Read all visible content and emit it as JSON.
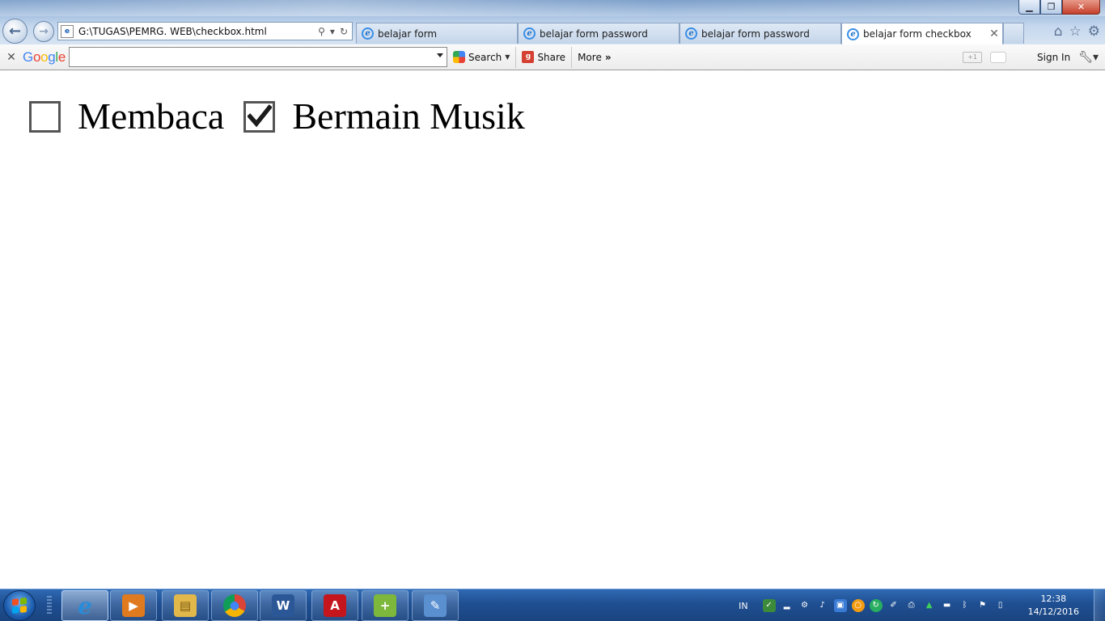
{
  "window": {
    "minimize_glyph": "▁",
    "restore_glyph": "❐",
    "close_glyph": "✕"
  },
  "nav": {
    "back_glyph": "←",
    "forward_glyph": "→",
    "address": "G:\\TUGAS\\PEMRG. WEB\\checkbox.html",
    "address_icons": [
      "search-icon",
      "dropdown-icon",
      "refresh-icon"
    ]
  },
  "tabs": [
    {
      "label": "belajar form",
      "active": false
    },
    {
      "label": "belajar form password",
      "active": false
    },
    {
      "label": "belajar form password",
      "active": false
    },
    {
      "label": "belajar form checkbox",
      "active": true
    }
  ],
  "browser_icons": [
    "home-icon",
    "favorites-star-icon",
    "settings-gear-icon"
  ],
  "google_toolbar": {
    "logo_letters": [
      "G",
      "o",
      "o",
      "g",
      "l",
      "e"
    ],
    "search_value": "",
    "search_button": "Search",
    "share_button": "Share",
    "more_button": "More",
    "more_glyph": "»",
    "sign_in": "Sign In"
  },
  "page": {
    "checkboxes": [
      {
        "label": "Membaca",
        "checked": false
      },
      {
        "label": "Bermain Musik",
        "checked": true
      }
    ]
  },
  "taskbar": {
    "apps": [
      {
        "name": "internet-explorer",
        "glyph": "e",
        "color": "#2a8cd8",
        "active": true
      },
      {
        "name": "media-player",
        "glyph": "▶",
        "color": "#e07a1f",
        "active": false
      },
      {
        "name": "file-explorer",
        "glyph": "▤",
        "color": "#e2b84a",
        "active": false
      },
      {
        "name": "chrome",
        "glyph": "●",
        "color": "#d9463b",
        "active": false
      },
      {
        "name": "word",
        "glyph": "W",
        "color": "#2b5797",
        "active": false
      },
      {
        "name": "adobe-reader",
        "glyph": "A",
        "color": "#c4161c",
        "active": false
      },
      {
        "name": "notepad-plus-plus",
        "glyph": "+",
        "color": "#7db83c",
        "active": false
      },
      {
        "name": "paint",
        "glyph": "✎",
        "color": "#5a8fd0",
        "active": false
      }
    ],
    "tray_language": "IN",
    "tray_icons": [
      "network-shield-icon",
      "signal-icon",
      "bluetooth-device-icon",
      "volume-icon",
      "display-icon",
      "orange-circle-icon",
      "sync-icon",
      "tool-icon",
      "printer-icon",
      "triangle-app-icon",
      "monitor-icon",
      "bluetooth-icon",
      "flag-icon",
      "power-icon"
    ],
    "clock_time": "12:38",
    "clock_date": "14/12/2016"
  }
}
